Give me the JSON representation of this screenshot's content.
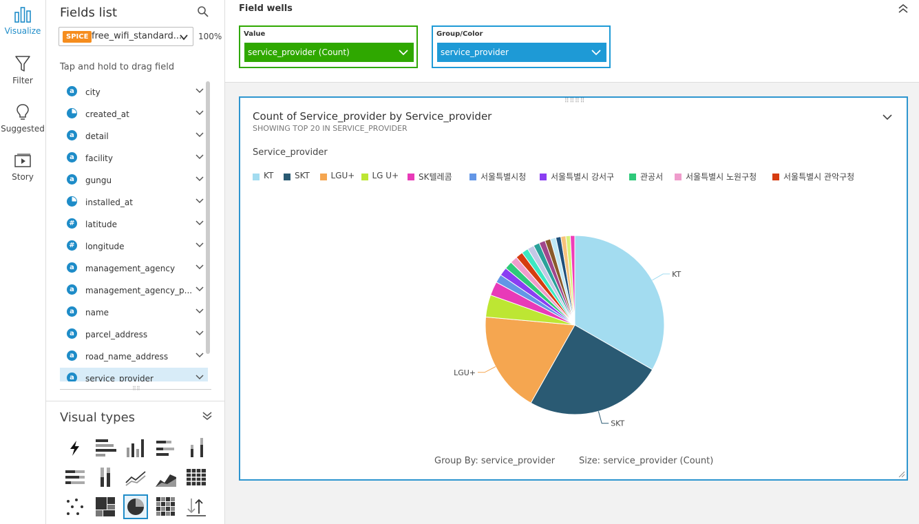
{
  "rail": {
    "items": [
      {
        "label": "Visualize",
        "icon": "bar-chart-icon"
      },
      {
        "label": "Filter",
        "icon": "filter-icon"
      },
      {
        "label": "Suggested",
        "icon": "lightbulb-icon"
      },
      {
        "label": "Story",
        "icon": "story-icon"
      }
    ]
  },
  "fields_panel": {
    "title": "Fields list",
    "dataset": {
      "badge": "SPICE",
      "name": "free_wifi_standard...",
      "percent": "100%"
    },
    "hint": "Tap and hold to drag field",
    "fields": [
      {
        "name": "city",
        "type": "a"
      },
      {
        "name": "created_at",
        "type": "time"
      },
      {
        "name": "detail",
        "type": "a"
      },
      {
        "name": "facility",
        "type": "a"
      },
      {
        "name": "gungu",
        "type": "a"
      },
      {
        "name": "installed_at",
        "type": "time"
      },
      {
        "name": "latitude",
        "type": "#"
      },
      {
        "name": "longitude",
        "type": "#"
      },
      {
        "name": "management_agency",
        "type": "a"
      },
      {
        "name": "management_agency_p...",
        "type": "a"
      },
      {
        "name": "name",
        "type": "a"
      },
      {
        "name": "parcel_address",
        "type": "a"
      },
      {
        "name": "road_name_address",
        "type": "a"
      },
      {
        "name": "service_provider",
        "type": "a",
        "selected": true
      }
    ]
  },
  "visual_types": {
    "title": "Visual types",
    "selected": "pie"
  },
  "field_wells": {
    "title": "Field wells",
    "value": {
      "label": "Value",
      "field": "service_provider (Count)"
    },
    "group": {
      "label": "Group/Color",
      "field": "service_provider"
    }
  },
  "visual": {
    "title": "Count of Service_provider by Service_provider",
    "subtitle": "SHOWING TOP 20 IN SERVICE_PROVIDER",
    "legend_title": "Service_provider",
    "footer_group": "Group By: service_provider",
    "footer_size": "Size: service_provider (Count)"
  },
  "chart_data": {
    "type": "pie",
    "title": "Count of Service_provider by Service_provider",
    "subtitle": "SHOWING TOP 20 IN SERVICE_PROVIDER",
    "legend_title": "Service_provider",
    "legend_position": "top",
    "slices": [
      {
        "label": "KT",
        "share": 0.332,
        "color": "#a3dcf0",
        "show_label": true
      },
      {
        "label": "SKT",
        "share": 0.248,
        "color": "#2a5a73",
        "show_label": true
      },
      {
        "label": "LGU+",
        "share": 0.182,
        "color": "#f5a650",
        "show_label": true
      },
      {
        "label": "LG U+",
        "share": 0.04,
        "color": "#bde633",
        "show_label": false
      },
      {
        "label": "SK텔레콤",
        "share": 0.025,
        "color": "#e83ab8",
        "show_label": false
      },
      {
        "label": "서울특별시청",
        "share": 0.015,
        "color": "#6396e6",
        "show_label": false
      },
      {
        "label": "서울특별시 강서구",
        "share": 0.015,
        "color": "#8a3ef2",
        "show_label": false
      },
      {
        "label": "관공서",
        "share": 0.014,
        "color": "#2ec97a",
        "show_label": false
      },
      {
        "label": "서울특별시 노원구청",
        "share": 0.013,
        "color": "#ef9ccc",
        "show_label": false
      },
      {
        "label": "서울특별시 관악구청",
        "share": 0.013,
        "color": "#d63c10",
        "show_label": false
      },
      {
        "label": "",
        "share": 0.012,
        "color": "#3de8c2",
        "show_label": false
      },
      {
        "label": "",
        "share": 0.012,
        "color": "#c4c8e6",
        "show_label": false
      },
      {
        "label": "",
        "share": 0.011,
        "color": "#2aa19a",
        "show_label": false
      },
      {
        "label": "",
        "share": 0.011,
        "color": "#a0468c",
        "show_label": false
      },
      {
        "label": "",
        "share": 0.01,
        "color": "#8a5a2a",
        "show_label": false
      },
      {
        "label": "",
        "share": 0.01,
        "color": "#bfe8f5",
        "show_label": false
      },
      {
        "label": "",
        "share": 0.009,
        "color": "#1f4f7a",
        "show_label": false
      },
      {
        "label": "",
        "share": 0.009,
        "color": "#f7c27a",
        "show_label": false
      },
      {
        "label": "",
        "share": 0.008,
        "color": "#d8f07a",
        "show_label": false
      },
      {
        "label": "",
        "share": 0.008,
        "color": "#f03cb8",
        "show_label": false
      }
    ]
  },
  "colors": {
    "accent": "#1e8cc8",
    "value_well": "#2fa800",
    "group_well": "#1e9ad6"
  }
}
